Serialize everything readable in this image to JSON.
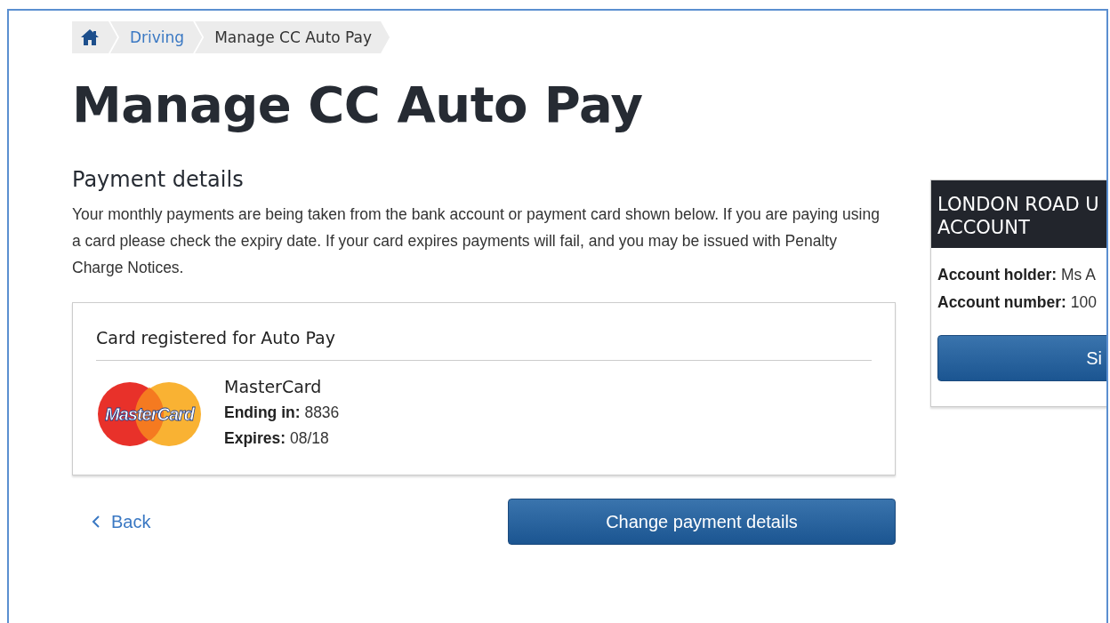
{
  "breadcrumbs": [
    {
      "kind": "home"
    },
    {
      "kind": "link",
      "label": "Driving"
    },
    {
      "kind": "current",
      "label": "Manage CC Auto Pay"
    }
  ],
  "title": "Manage CC Auto Pay",
  "section_heading": "Payment details",
  "intro": "Your monthly payments are being taken from the bank account or payment card shown below. If you are paying using a card please check the expiry date. If your card expires payments will fail, and you may be issued with Penalty Charge Notices.",
  "card_panel": {
    "heading": "Card registered for Auto Pay",
    "logo_text": "MasterCard",
    "card_name": "MasterCard",
    "details": [
      {
        "label": "Ending in:",
        "value": "8836"
      },
      {
        "label": "Expires:",
        "value": "08/18"
      }
    ]
  },
  "back_link": "Back",
  "primary_button": "Change payment details",
  "account_panel": {
    "title_lines": [
      "LONDON ROAD U",
      "ACCOUNT"
    ],
    "fields": [
      {
        "label": "Account holder:",
        "value": "Ms A"
      },
      {
        "label": "Account number:",
        "value": "100"
      }
    ],
    "button": "Si"
  }
}
